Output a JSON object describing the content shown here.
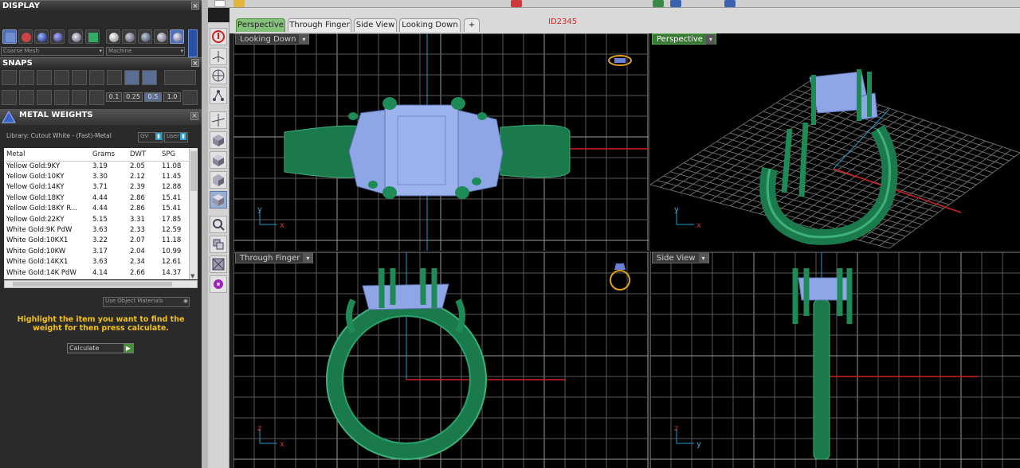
{
  "panels": {
    "display": {
      "title": "DISPLAY",
      "mesh_select": "Coarse Mesh",
      "material_select": "Machine"
    },
    "snaps": {
      "title": "SNAPS",
      "increments": [
        "0.1",
        "0.25",
        "0.5",
        "1.0"
      ]
    },
    "metal_weights": {
      "title": "METAL WEIGHTS",
      "library": "Library: Cutout White - (Fast)-Metal",
      "gv_label": "GV",
      "user_label": "User",
      "columns": [
        "Metal",
        "Grams",
        "DWT",
        "SPG"
      ],
      "rows": [
        [
          "Yellow Gold:9KY",
          "3.19",
          "2.05",
          "11.08"
        ],
        [
          "Yellow Gold:10KY",
          "3.30",
          "2.12",
          "11.45"
        ],
        [
          "Yellow Gold:14KY",
          "3.71",
          "2.39",
          "12.88"
        ],
        [
          "Yellow Gold:18KY",
          "4.44",
          "2.86",
          "15.41"
        ],
        [
          "Yellow Gold:18KY R...",
          "4.44",
          "2.86",
          "15.41"
        ],
        [
          "Yellow Gold:22KY",
          "5.15",
          "3.31",
          "17.85"
        ],
        [
          "White Gold:9K PdW",
          "3.63",
          "2.33",
          "12.59"
        ],
        [
          "White Gold:10KX1",
          "3.22",
          "2.07",
          "11.18"
        ],
        [
          "White Gold:10KW",
          "3.17",
          "2.04",
          "10.99"
        ],
        [
          "White Gold:14KX1",
          "3.63",
          "2.34",
          "12.61"
        ],
        [
          "White Gold:14K PdW",
          "4.14",
          "2.66",
          "14.37"
        ]
      ],
      "materials_select": "Use Object Materials",
      "hint": "Highlight the item you want to find the weight for then press calculate.",
      "calculate_select": "Calculate"
    }
  },
  "tabs": [
    "Perspective",
    "Through Finger",
    "Side View",
    "Looking Down",
    "+"
  ],
  "id_label": "ID2345",
  "viewports": {
    "top_left": {
      "label": "Looking Down",
      "axes": [
        "y",
        "x"
      ]
    },
    "top_right": {
      "label": "Perspective",
      "axes": [
        "y",
        "x"
      ]
    },
    "bottom_left": {
      "label": "Through Finger",
      "axes": [
        "z",
        "x"
      ]
    },
    "bottom_right": {
      "label": "Side View",
      "axes": [
        "z",
        "y"
      ]
    }
  },
  "colors": {
    "metal": "#1e8a56",
    "stone": "#8fa6e6",
    "grid": "#7a7a7a",
    "x_axis": "#d02020",
    "y_axis": "#1e9ad0"
  }
}
